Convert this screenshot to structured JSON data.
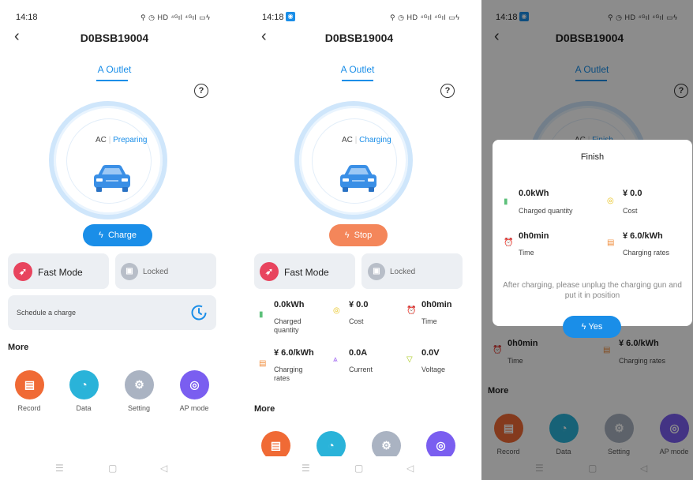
{
  "status_time": "14:18",
  "status_icons": "⚲ ◷ HD ⁴ᴳıl ⁴ᴳıl ▭ϟ",
  "device_title": "D0BSB19004",
  "tab_label": "A Outlet",
  "help_symbol": "?",
  "ac_label": "AC",
  "colors": {
    "accent": "#1a8ee8",
    "stop": "#f4865a",
    "fast": "#e8445e"
  },
  "screen1": {
    "state": "Preparing",
    "charge_button": "Charge",
    "fast_mode": "Fast Mode",
    "locked": "Locked",
    "schedule": "Schedule a charge",
    "more": "More",
    "icons": [
      {
        "label": "Record"
      },
      {
        "label": "Data"
      },
      {
        "label": "Setting"
      },
      {
        "label": "AP mode"
      }
    ]
  },
  "screen2": {
    "state": "Charging",
    "stop_button": "Stop",
    "fast_mode": "Fast Mode",
    "locked": "Locked",
    "stats": [
      {
        "value": "0.0kWh",
        "label": "Charged quantity"
      },
      {
        "value": "¥ 0.0",
        "label": "Cost"
      },
      {
        "value": "0h0min",
        "label": "Time"
      },
      {
        "value": "¥ 6.0/kWh",
        "label": "Charging rates"
      },
      {
        "value": "0.0A",
        "label": "Current"
      },
      {
        "value": "0.0V",
        "label": "Voltage"
      }
    ],
    "more": "More"
  },
  "screen3": {
    "behind_state": "Finish",
    "behind_time": "0h0min",
    "behind_time_label": "Time",
    "behind_rate": "¥ 6.0/kWh",
    "behind_rate_label": "Charging rates",
    "more": "More",
    "icons": [
      {
        "label": "Record"
      },
      {
        "label": "Data"
      },
      {
        "label": "Setting"
      },
      {
        "label": "AP mode"
      }
    ],
    "modal": {
      "title": "Finish",
      "stats": [
        {
          "value": "0.0kWh",
          "label": "Charged quantity"
        },
        {
          "value": "¥ 0.0",
          "label": "Cost"
        },
        {
          "value": "0h0min",
          "label": "Time"
        },
        {
          "value": "¥ 6.0/kWh",
          "label": "Charging rates"
        }
      ],
      "message": "After charging, please unplug the charging gun and put it in position",
      "yes_button": "Yes"
    }
  },
  "nav": {
    "menu": "☰",
    "home": "▢",
    "back": "◁"
  }
}
